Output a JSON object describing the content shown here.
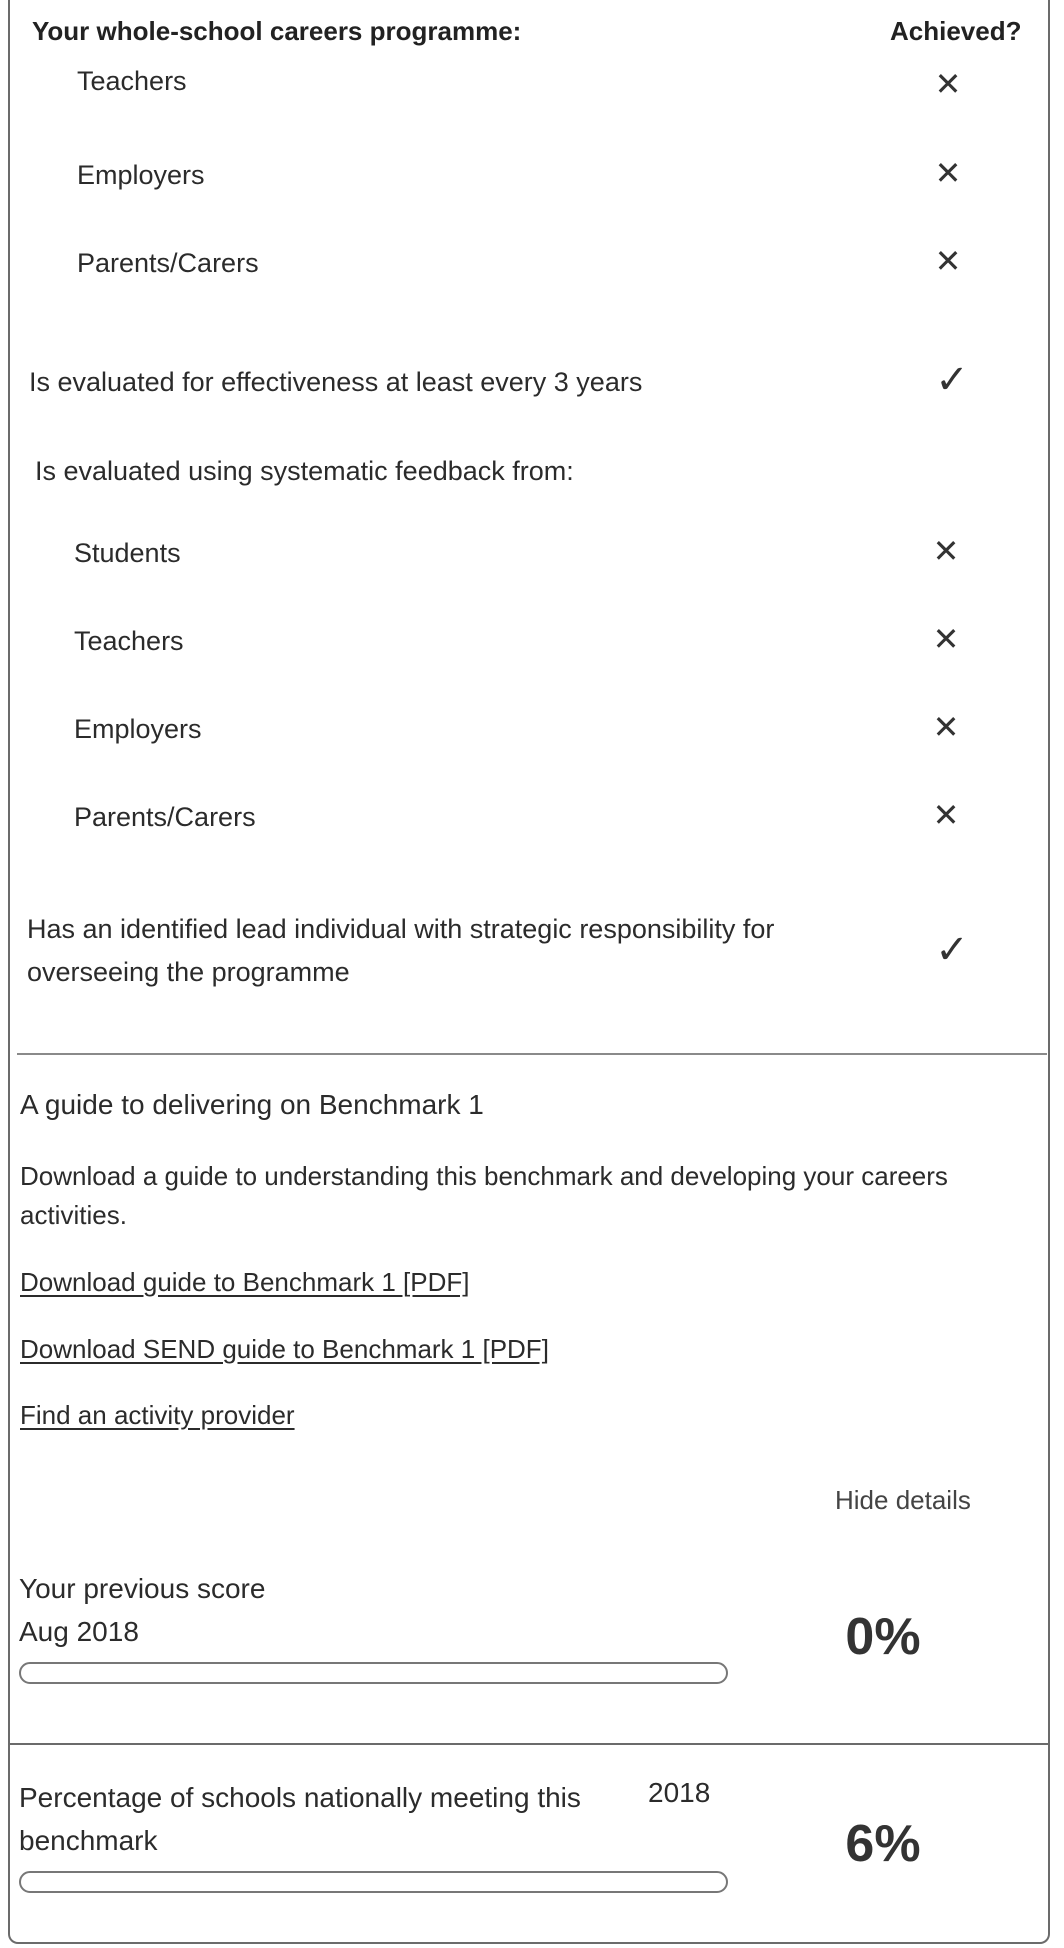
{
  "header": {
    "programme_title": "Your whole-school careers programme:",
    "achieved_label": "Achieved?"
  },
  "rows_top": [
    {
      "label": "Teachers",
      "status": "cross"
    },
    {
      "label": "Employers",
      "status": "cross"
    },
    {
      "label": "Parents/Carers",
      "status": "cross"
    }
  ],
  "evaluated_effectiveness": {
    "label": "Is evaluated for effectiveness at least every 3 years",
    "status": "tick"
  },
  "feedback_heading": "Is evaluated using systematic feedback from:",
  "rows_feedback": [
    {
      "label": "Students",
      "status": "cross"
    },
    {
      "label": "Teachers",
      "status": "cross"
    },
    {
      "label": "Employers",
      "status": "cross"
    },
    {
      "label": "Parents/Carers",
      "status": "cross"
    }
  ],
  "lead_individual": {
    "line1": "Has an identified lead individual with strategic responsibility for",
    "line2": "overseeing the programme",
    "status": "tick"
  },
  "symbols": {
    "cross": "✕",
    "tick": "✓"
  },
  "guide": {
    "title": "A guide to delivering on Benchmark 1",
    "description_line1": "Download a guide to understanding this benchmark and developing your careers",
    "description_line2": "activities.",
    "links": [
      "Download guide to Benchmark 1 [PDF]",
      "Download SEND guide to Benchmark 1 [PDF]",
      "Find an activity provider"
    ],
    "hide_details": "Hide details"
  },
  "previous_score": {
    "label": "Your previous score",
    "date": "Aug 2018",
    "percentage": "0%",
    "fill_fraction": 0.0
  },
  "national": {
    "line1": "Percentage of schools nationally meeting this",
    "line2": "benchmark",
    "year": "2018",
    "percentage": "6%",
    "fill_fraction": 0.0
  }
}
